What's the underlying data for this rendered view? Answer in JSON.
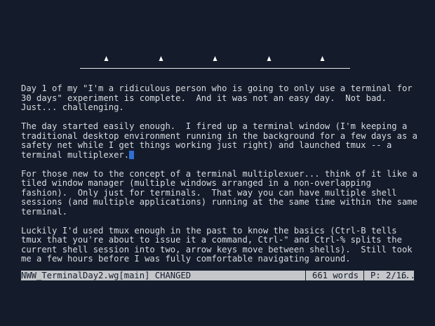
{
  "document": {
    "paragraphs": [
      {
        "lines": [
          "Day 1 of my \"I'm a ridiculous person who is going to only use a terminal for",
          "30 days\" experiment is complete.  And it was not an easy day.  Not bad.",
          "Just... challenging."
        ]
      },
      {
        "lines": [
          "The day started easily enough.  I fired up a terminal window (I'm keeping a",
          "traditional desktop environment running in the background for a few days as a",
          "safety net while I get things working just right) and launched tmux -- a",
          "terminal multiplexer."
        ]
      },
      {
        "lines": [
          "For those new to the concept of a terminal multiplexuer... think of it like a",
          "tiled window manager (multiple windows arranged in a non-overlapping",
          "fashion).  Only just for terminals.  That way you can have multiple shell",
          "sessions (and multiple applications) running at the same time within the same",
          "terminal."
        ]
      },
      {
        "lines": [
          "Luckily I'd used tmux enough in the past to know the basics (Ctrl-B tells",
          "tmux that you're about to issue it a command, Ctrl-\" and Ctrl-% splits the",
          "current shell session into two, arrow keys move between shells).  Still took",
          "me a few hours before I was fully comfortable navigating around."
        ]
      }
    ]
  },
  "status": {
    "file": "NWW_TerminalDay2.wg[main] CHANGED",
    "words": "661 words",
    "page": "P: 2/16",
    "more": "..."
  },
  "colors": {
    "background": "#141c2b",
    "text": "#d8dbe0",
    "cursor": "#2f6fd6",
    "statusbar": "#c4c6ca"
  }
}
